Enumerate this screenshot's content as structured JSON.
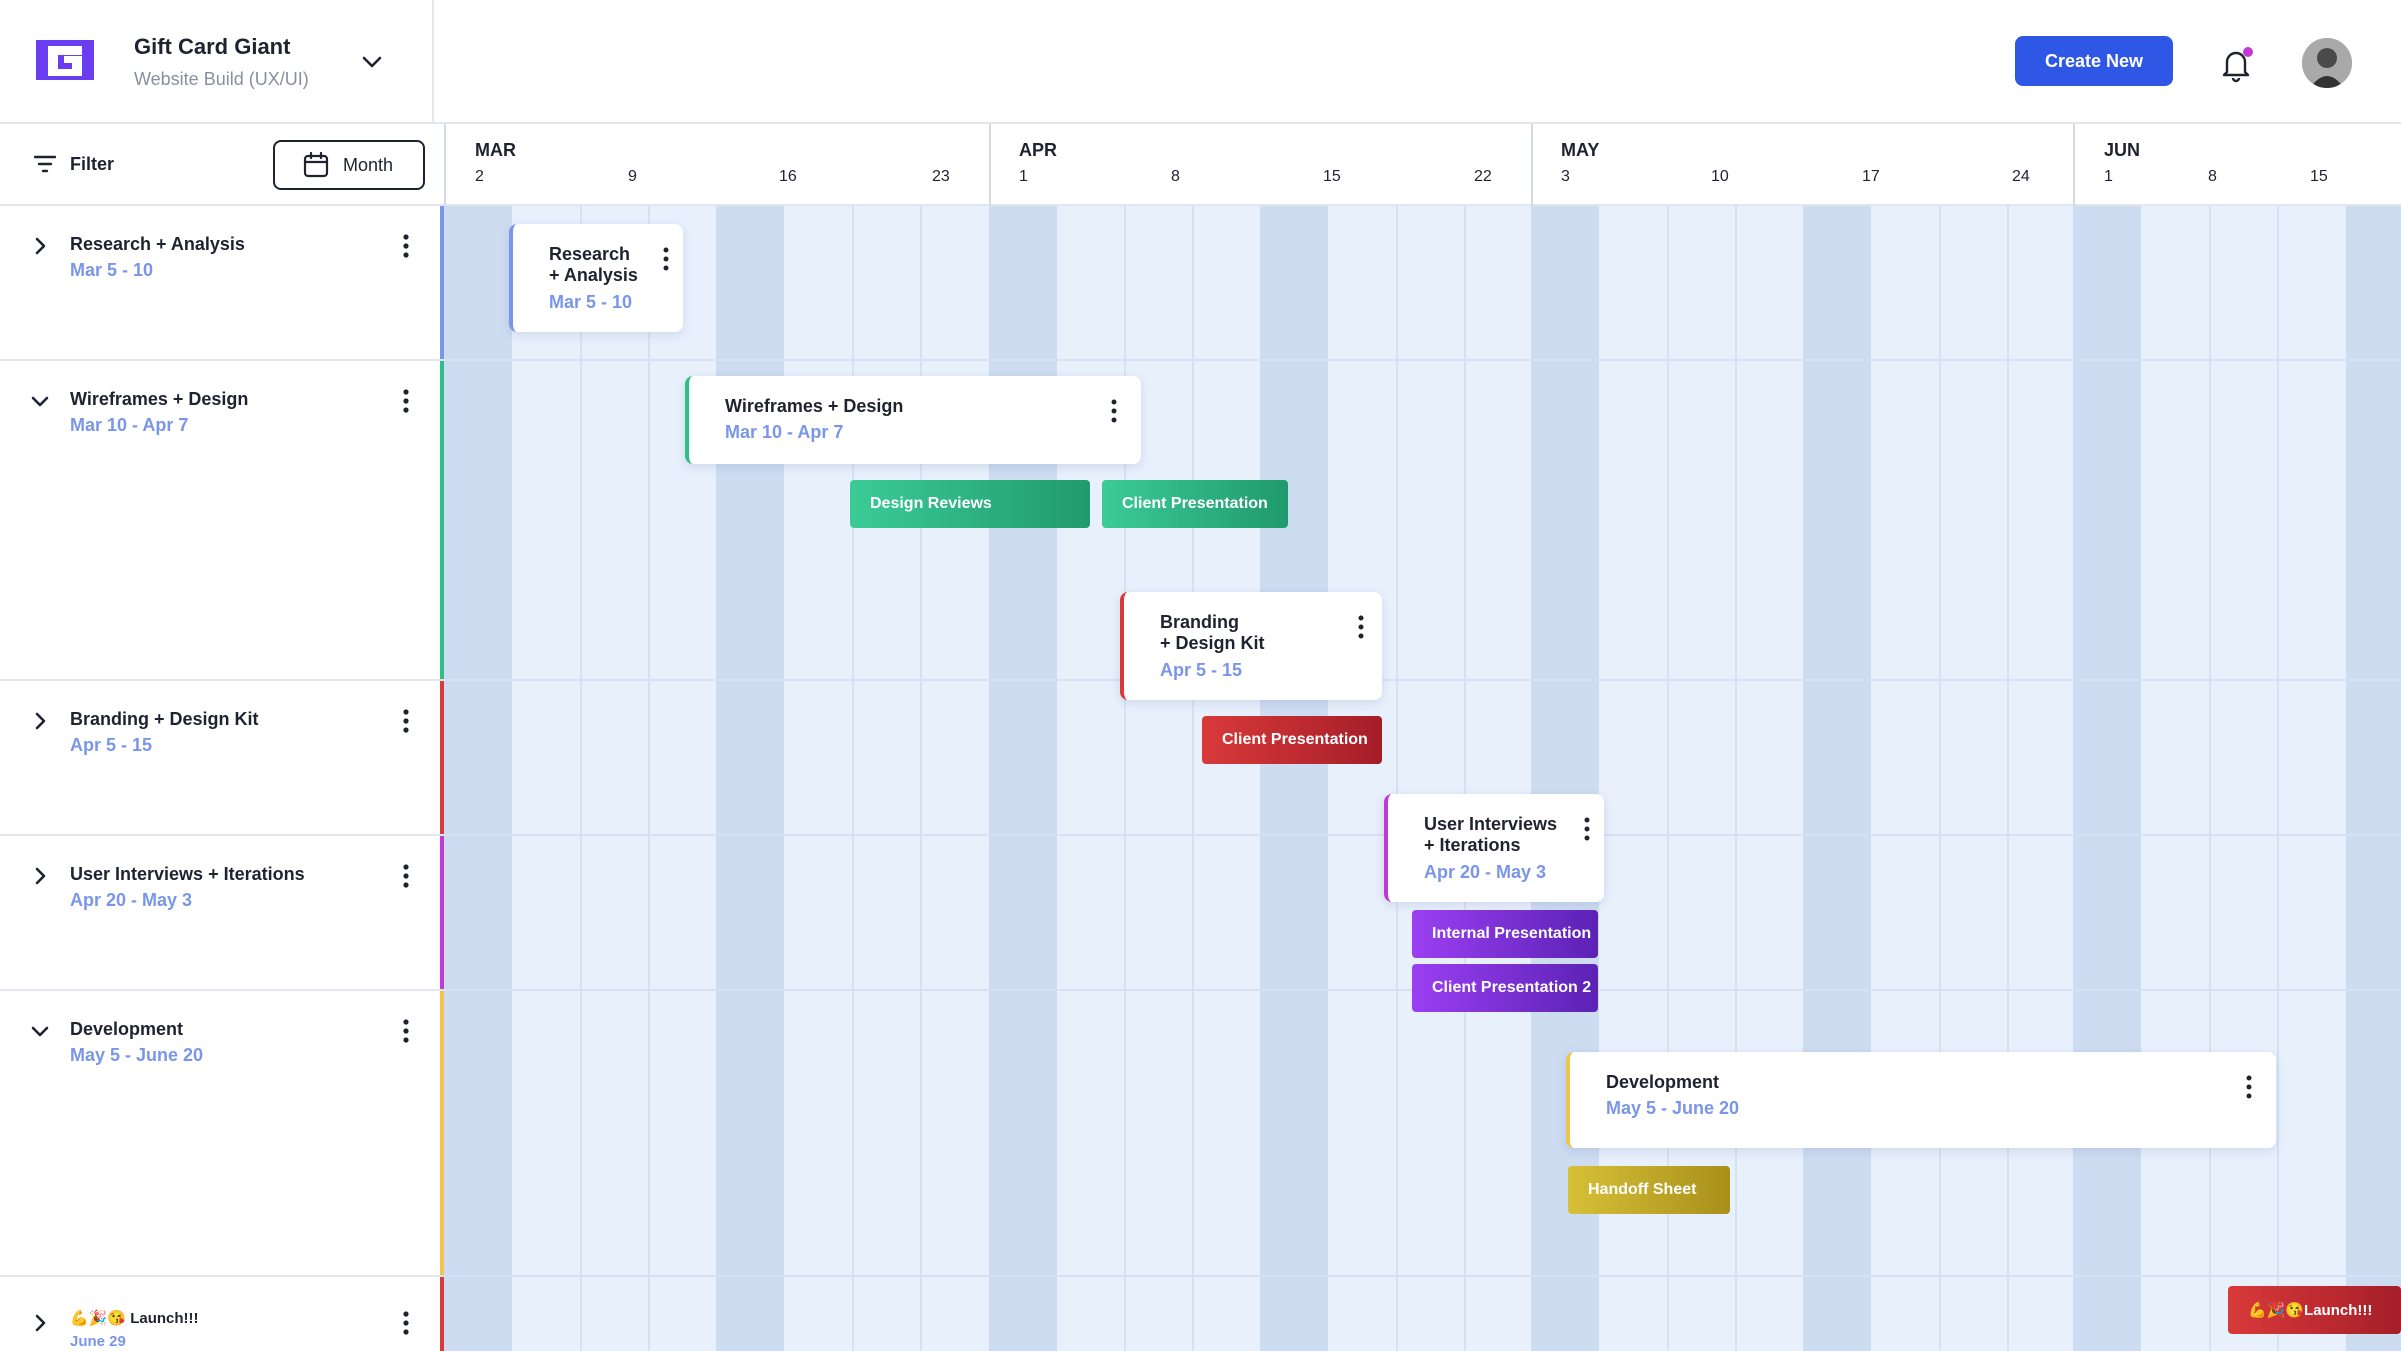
{
  "header": {
    "logo_icon": "g-logo-icon",
    "project_name": "Gift Card Giant",
    "project_subtitle": "Website Build (UX/UI)",
    "create_button": "Create New",
    "accent_color": "#2f57e5",
    "notification_dot_color": "#c23ad6"
  },
  "toolbar": {
    "filter_label": "Filter",
    "view_label": "Month"
  },
  "timeline": {
    "months": [
      {
        "label": "MAR",
        "days": [
          "2",
          "9",
          "16",
          "23"
        ]
      },
      {
        "label": "APR",
        "days": [
          "1",
          "8",
          "15",
          "22"
        ]
      },
      {
        "label": "MAY",
        "days": [
          "3",
          "10",
          "17",
          "24"
        ]
      },
      {
        "label": "JUN",
        "days": [
          "1",
          "8",
          "15"
        ]
      }
    ]
  },
  "rows": [
    {
      "title": "Research + Analysis",
      "dates": "Mar 5 - 10",
      "expanded": false,
      "color": "#7a96e8"
    },
    {
      "title": "Wireframes + Design",
      "dates": "Mar 10 -  Apr 7",
      "expanded": true,
      "color": "#2ebf86"
    },
    {
      "title": "Branding + Design Kit",
      "dates": "Apr 5 - 15",
      "expanded": false,
      "color": "#d93a3a"
    },
    {
      "title": "User Interviews + Iterations",
      "dates": "Apr 20 - May 3",
      "expanded": false,
      "color": "#c23ad6"
    },
    {
      "title": "Development",
      "dates": "May 5 - June 20",
      "expanded": true,
      "color": "#f0c44a"
    },
    {
      "title": "💪🎉😘 Launch!!!",
      "dates": "June 29",
      "expanded": false,
      "color": "#d93a3a"
    }
  ],
  "cards": [
    {
      "title_line1": "Research",
      "title_line2": "+ Analysis",
      "dates": "Mar 5 - 10",
      "color": "#7a96e8"
    },
    {
      "title_line1": "Wireframes + Design",
      "title_line2": "",
      "dates": "Mar 10 -  Apr 7",
      "color": "#2ebf86"
    },
    {
      "title_line1": "Branding",
      "title_line2": "+ Design Kit",
      "dates": "Apr 5 - 15",
      "color": "#d93a3a"
    },
    {
      "title_line1": "User Interviews",
      "title_line2": "+ Iterations",
      "dates": "Apr 20 - May 3",
      "color": "#c23ad6"
    },
    {
      "title_line1": "Development",
      "title_line2": "",
      "dates": "May 5 - June 20",
      "color": "#f0c44a"
    }
  ],
  "chips": {
    "design_reviews": "Design Reviews",
    "client_presentation_wire": "Client Presentation",
    "client_presentation_brand": "Client Presentation",
    "internal_presentation": "Internal  Presentation",
    "client_presentation_2": "Client Presentation 2",
    "handoff_sheet": "Handoff Sheet",
    "launch": "💪🎉😘Launch!!!"
  }
}
